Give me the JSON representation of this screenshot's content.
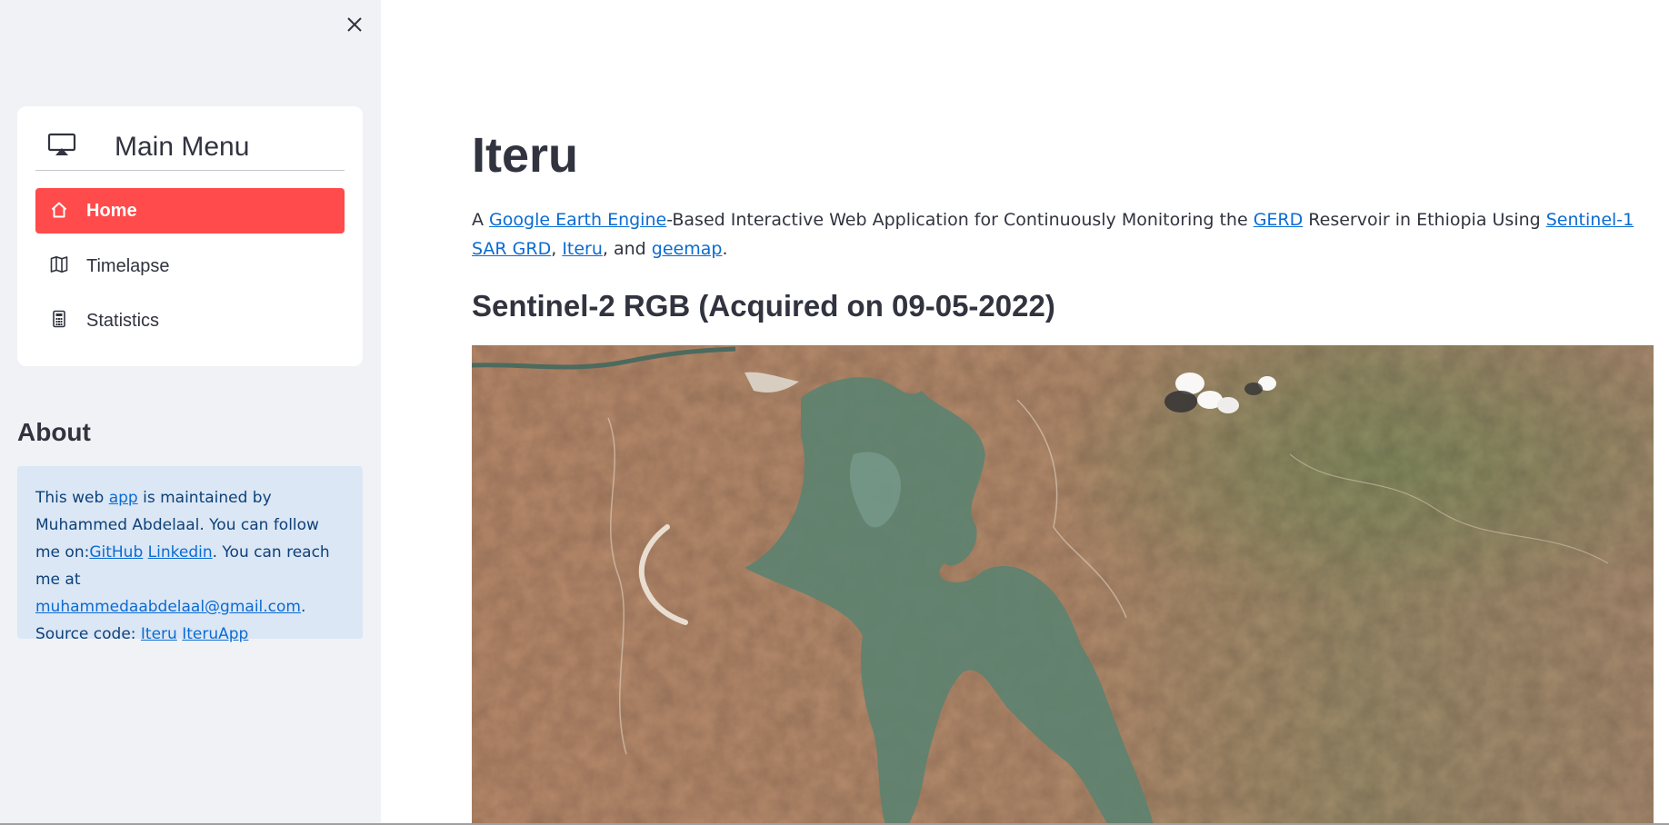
{
  "sidebar": {
    "close_icon": "close-icon",
    "menu": {
      "title": "Main Menu",
      "header_icon": "airplay-icon",
      "items": [
        {
          "label": "Home",
          "icon": "house-icon",
          "active": true
        },
        {
          "label": "Timelapse",
          "icon": "map-icon",
          "active": false
        },
        {
          "label": "Statistics",
          "icon": "calculator-icon",
          "active": false
        }
      ],
      "accent_color": "#ff4b4b"
    },
    "about": {
      "title": "About",
      "text_1": "This web ",
      "link_app": "app",
      "text_2": " is maintained by Muhammed Abdelaal. You can follow me on:",
      "link_github": "GitHub",
      "text_3": " ",
      "link_linkedin": "Linkedin",
      "text_4": ". You can reach me at ",
      "link_email": "muhammedaabdelaal@gmail.com",
      "text_5": ". Source code: ",
      "link_iteru": "Iteru",
      "text_6": " ",
      "link_iteruapp": "IteruApp"
    }
  },
  "main": {
    "title": "Iteru",
    "intro": {
      "t1": "A ",
      "link_gee": "Google Earth Engine",
      "t2": "-Based Interactive Web Application for Continuously Monitoring the ",
      "link_gerd": "GERD",
      "t3": " Reservoir in Ethiopia Using ",
      "link_s1": "Sentinel-1 SAR GRD",
      "t4": ", ",
      "link_iteru": "Iteru",
      "t5": ", and ",
      "link_geemap": "geemap",
      "t6": "."
    },
    "subtitle": "Sentinel-2 RGB (Acquired on 09-05-2022)",
    "image_alt": "satellite-image"
  }
}
